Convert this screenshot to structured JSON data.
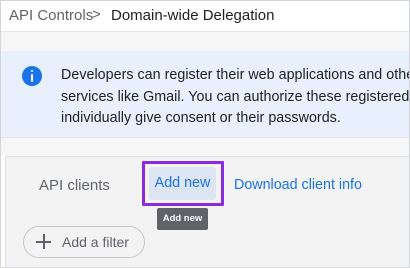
{
  "breadcrumb": {
    "parent": "API Controls",
    "separator": ">",
    "current": "Domain-wide Delegation"
  },
  "info_banner": {
    "icon": "info-icon",
    "lines": [
      "Developers can register their web applications and other",
      "services like Gmail. You can authorize these registered c",
      "individually give consent or their passwords."
    ]
  },
  "api_clients": {
    "title": "API clients",
    "add_new_label": "Add new",
    "download_label": "Download client info",
    "tooltip": "Add new",
    "add_filter_label": "Add a filter"
  },
  "colors": {
    "accent": "#1a73e8",
    "highlight": "#8a2be2",
    "banner_bg": "#e8f0fe"
  }
}
